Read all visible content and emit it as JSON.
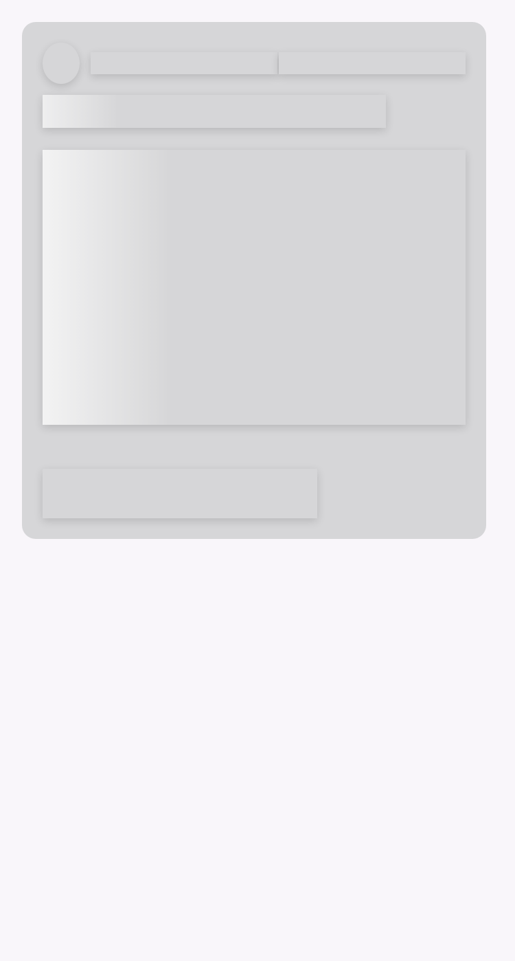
{
  "screen": {
    "state": "loading",
    "background_color": "#f9f6fa",
    "skeleton_color": "#d6d6d8",
    "shimmer_highlight_color": "#f3f3f3"
  },
  "card": {
    "placeholders": [
      "avatar",
      "header-line",
      "header-line",
      "title-line",
      "media-block",
      "action-block"
    ]
  }
}
